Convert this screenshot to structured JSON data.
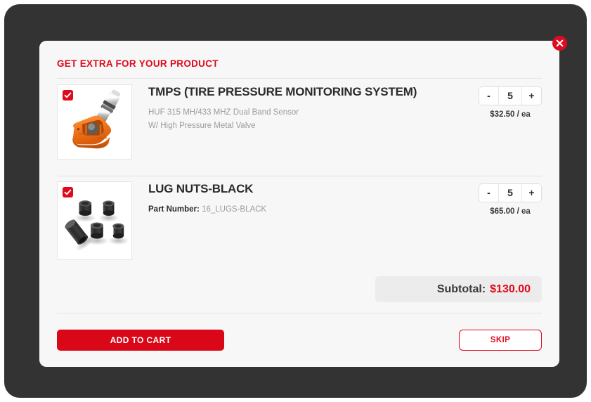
{
  "modal": {
    "title": "GET EXTRA FOR YOUR PRODUCT",
    "close_icon": "close-icon"
  },
  "products": [
    {
      "image": "tpms-sensor-image",
      "checkbox_checked": true,
      "name": "TMPS (TIRE PRESSURE MONITORING SYSTEM)",
      "desc_line_1": "HUF 315 MH/433 MHZ Dual Band Sensor",
      "desc_line_2": "W/ High Pressure Metal Valve",
      "qty": "5",
      "decrement_label": "-",
      "increment_label": "+",
      "unit_price": "$32.50 / ea"
    },
    {
      "image": "lug-nuts-image",
      "checkbox_checked": true,
      "name": "LUG NUTS-BLACK",
      "part_number_label": "Part Number:",
      "part_number_value": "16_LUGS-BLACK",
      "qty": "5",
      "decrement_label": "-",
      "increment_label": "+",
      "unit_price": "$65.00 / ea"
    }
  ],
  "subtotal": {
    "label": "Subtotal:",
    "value": "$130.00"
  },
  "footer": {
    "add_to_cart_label": "ADD TO CART",
    "skip_label": "SKIP"
  },
  "colors": {
    "brand_red": "#e00a1e",
    "button_red": "#d90718",
    "frame_dark": "#333333",
    "modal_bg": "#f7f7f7",
    "subtotal_bg": "#ececec"
  }
}
